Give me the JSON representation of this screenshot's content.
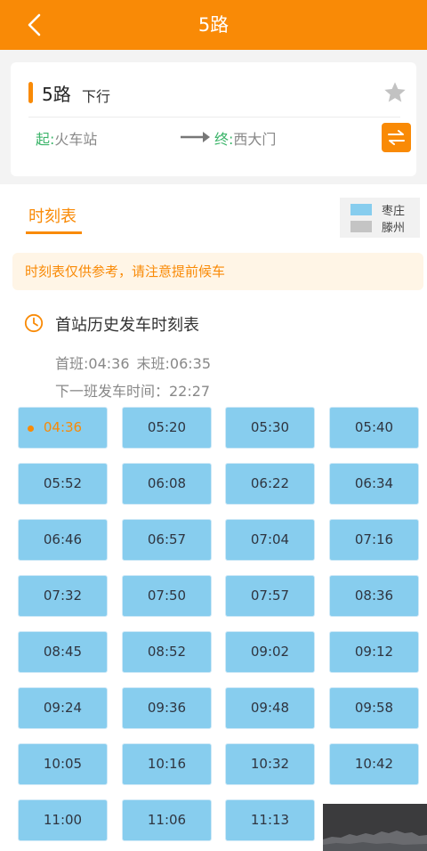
{
  "header": {
    "title": "5路"
  },
  "route": {
    "name": "5路",
    "direction": "下行",
    "from_tag": "起:",
    "from_stop": "火车站",
    "to_tag": "终:",
    "to_stop": "西大门"
  },
  "tab": {
    "label": "时刻表"
  },
  "legend": [
    {
      "label": "枣庄",
      "color": "#87cdee"
    },
    {
      "label": "滕州",
      "color": "#c4c4c4"
    }
  ],
  "notice": "时刻表仅供参考，请注意提前候车",
  "schedule": {
    "title": "首站历史发车时刻表",
    "first_bus": "首班:04:36",
    "last_bus": "末班:06:35",
    "next_bus": "下一班发车时间：22:27",
    "times": [
      "04:36",
      "05:20",
      "05:30",
      "05:40",
      "05:52",
      "06:08",
      "06:22",
      "06:34",
      "06:46",
      "06:57",
      "07:04",
      "07:16",
      "07:32",
      "07:50",
      "07:57",
      "08:36",
      "08:45",
      "08:52",
      "09:02",
      "09:12",
      "09:24",
      "09:36",
      "09:48",
      "09:58",
      "10:05",
      "10:16",
      "10:32",
      "10:42",
      "11:00",
      "11:06",
      "11:13"
    ],
    "active_index": 0
  },
  "colors": {
    "accent": "#f98a06",
    "time_button": "#87cdee",
    "stop_tag": "#3cb46a"
  }
}
